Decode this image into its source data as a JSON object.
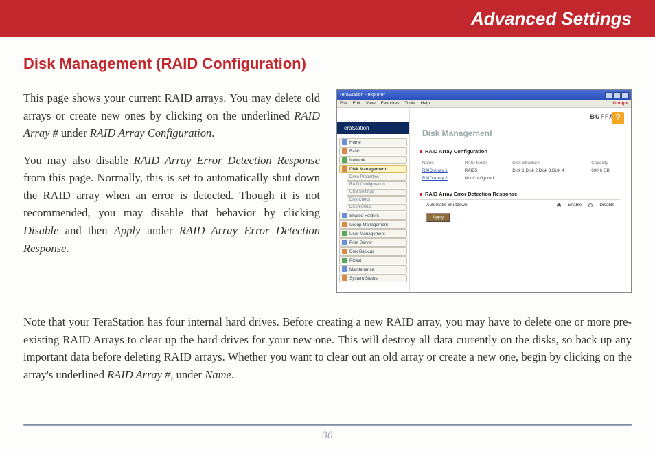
{
  "header": {
    "title": "Advanced Settings"
  },
  "section": {
    "title": "Disk Management (RAID Configuration)"
  },
  "para1_a": "This page shows your current RAID arrays. You may delete old arrays or create new ones by clicking on the underlined ",
  "para1_b": "RAID Array #",
  "para1_c": " under ",
  "para1_d": "RAID Array Configuration",
  "para1_e": ".",
  "para2_a": "You may also disable ",
  "para2_b": "RAID Array Error Detection Response",
  "para2_c": " from this page.  Normally, this is set to automatically shut down the RAID array when an error is detected.  Though it is not recommended, you may disable that behavior by clicking ",
  "para2_d": "Disable",
  "para2_e": " and then ",
  "para2_f": "Apply",
  "para2_g": " under ",
  "para2_h": "RAID Array Error Detection Response",
  "para2_i": ".",
  "para3_a": "Note that your TeraStation has four internal hard drives.  Before creating a new RAID array, you may have to delete one or more pre-existing RAID Arrays to clear up the hard drives for your new one.  This will destroy all data currently on the disks, so back up any important data before deleting RAID arrays.  Whether you want to clear out an old array or create a new one, begin by clicking on the array's underlined ",
  "para3_b": "RAID Array #",
  "para3_c": ", under ",
  "para3_d": "Name",
  "para3_e": ".",
  "page_number": "30",
  "screenshot": {
    "window_title": "TeraStation - explorer",
    "menubar": [
      "File",
      "Edit",
      "View",
      "Favorites",
      "Tools",
      "Help"
    ],
    "search_brand": "Google",
    "brand": "BUFFALO",
    "product": "TeraStation",
    "help": "?",
    "nav": [
      "Home",
      "Basic",
      "Network",
      "Disk Management",
      "Drive Properties",
      "RAID Configuration",
      "USB Settings",
      "Disk Check",
      "Disk Format",
      "Shared Folders",
      "Group Management",
      "User Management",
      "Print Server",
      "Disk Backup",
      "PCast",
      "Maintenance",
      "System Status"
    ],
    "main_title": "Disk Management",
    "panel1": {
      "title": "RAID Array Configuration",
      "headers": [
        "Name",
        "RAID Mode",
        "Disk Structure",
        "Capacity"
      ],
      "row1": [
        "RAID Array 1",
        "RAID5",
        "Disk 1,Disk 2,Disk 3,Disk 4",
        "690.6 GB"
      ],
      "row2": [
        "RAID Array 2",
        "Not Configured",
        "",
        ""
      ]
    },
    "panel2": {
      "title": "RAID Array Error Detection Response",
      "label": "Automatic Shutdown",
      "opt_enable": "Enable",
      "opt_disable": "Disable",
      "apply": "Apply"
    }
  }
}
